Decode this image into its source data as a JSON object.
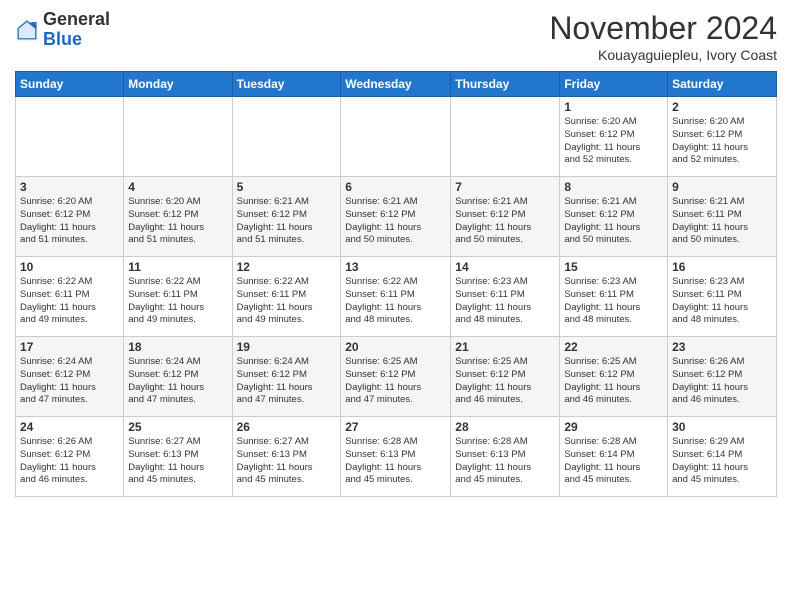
{
  "logo": {
    "general": "General",
    "blue": "Blue"
  },
  "header": {
    "month": "November 2024",
    "location": "Kouayaguiepleu, Ivory Coast"
  },
  "weekdays": [
    "Sunday",
    "Monday",
    "Tuesday",
    "Wednesday",
    "Thursday",
    "Friday",
    "Saturday"
  ],
  "weeks": [
    [
      {
        "day": "",
        "info": ""
      },
      {
        "day": "",
        "info": ""
      },
      {
        "day": "",
        "info": ""
      },
      {
        "day": "",
        "info": ""
      },
      {
        "day": "",
        "info": ""
      },
      {
        "day": "1",
        "info": "Sunrise: 6:20 AM\nSunset: 6:12 PM\nDaylight: 11 hours\nand 52 minutes."
      },
      {
        "day": "2",
        "info": "Sunrise: 6:20 AM\nSunset: 6:12 PM\nDaylight: 11 hours\nand 52 minutes."
      }
    ],
    [
      {
        "day": "3",
        "info": "Sunrise: 6:20 AM\nSunset: 6:12 PM\nDaylight: 11 hours\nand 51 minutes."
      },
      {
        "day": "4",
        "info": "Sunrise: 6:20 AM\nSunset: 6:12 PM\nDaylight: 11 hours\nand 51 minutes."
      },
      {
        "day": "5",
        "info": "Sunrise: 6:21 AM\nSunset: 6:12 PM\nDaylight: 11 hours\nand 51 minutes."
      },
      {
        "day": "6",
        "info": "Sunrise: 6:21 AM\nSunset: 6:12 PM\nDaylight: 11 hours\nand 50 minutes."
      },
      {
        "day": "7",
        "info": "Sunrise: 6:21 AM\nSunset: 6:12 PM\nDaylight: 11 hours\nand 50 minutes."
      },
      {
        "day": "8",
        "info": "Sunrise: 6:21 AM\nSunset: 6:12 PM\nDaylight: 11 hours\nand 50 minutes."
      },
      {
        "day": "9",
        "info": "Sunrise: 6:21 AM\nSunset: 6:11 PM\nDaylight: 11 hours\nand 50 minutes."
      }
    ],
    [
      {
        "day": "10",
        "info": "Sunrise: 6:22 AM\nSunset: 6:11 PM\nDaylight: 11 hours\nand 49 minutes."
      },
      {
        "day": "11",
        "info": "Sunrise: 6:22 AM\nSunset: 6:11 PM\nDaylight: 11 hours\nand 49 minutes."
      },
      {
        "day": "12",
        "info": "Sunrise: 6:22 AM\nSunset: 6:11 PM\nDaylight: 11 hours\nand 49 minutes."
      },
      {
        "day": "13",
        "info": "Sunrise: 6:22 AM\nSunset: 6:11 PM\nDaylight: 11 hours\nand 48 minutes."
      },
      {
        "day": "14",
        "info": "Sunrise: 6:23 AM\nSunset: 6:11 PM\nDaylight: 11 hours\nand 48 minutes."
      },
      {
        "day": "15",
        "info": "Sunrise: 6:23 AM\nSunset: 6:11 PM\nDaylight: 11 hours\nand 48 minutes."
      },
      {
        "day": "16",
        "info": "Sunrise: 6:23 AM\nSunset: 6:11 PM\nDaylight: 11 hours\nand 48 minutes."
      }
    ],
    [
      {
        "day": "17",
        "info": "Sunrise: 6:24 AM\nSunset: 6:12 PM\nDaylight: 11 hours\nand 47 minutes."
      },
      {
        "day": "18",
        "info": "Sunrise: 6:24 AM\nSunset: 6:12 PM\nDaylight: 11 hours\nand 47 minutes."
      },
      {
        "day": "19",
        "info": "Sunrise: 6:24 AM\nSunset: 6:12 PM\nDaylight: 11 hours\nand 47 minutes."
      },
      {
        "day": "20",
        "info": "Sunrise: 6:25 AM\nSunset: 6:12 PM\nDaylight: 11 hours\nand 47 minutes."
      },
      {
        "day": "21",
        "info": "Sunrise: 6:25 AM\nSunset: 6:12 PM\nDaylight: 11 hours\nand 46 minutes."
      },
      {
        "day": "22",
        "info": "Sunrise: 6:25 AM\nSunset: 6:12 PM\nDaylight: 11 hours\nand 46 minutes."
      },
      {
        "day": "23",
        "info": "Sunrise: 6:26 AM\nSunset: 6:12 PM\nDaylight: 11 hours\nand 46 minutes."
      }
    ],
    [
      {
        "day": "24",
        "info": "Sunrise: 6:26 AM\nSunset: 6:12 PM\nDaylight: 11 hours\nand 46 minutes."
      },
      {
        "day": "25",
        "info": "Sunrise: 6:27 AM\nSunset: 6:13 PM\nDaylight: 11 hours\nand 45 minutes."
      },
      {
        "day": "26",
        "info": "Sunrise: 6:27 AM\nSunset: 6:13 PM\nDaylight: 11 hours\nand 45 minutes."
      },
      {
        "day": "27",
        "info": "Sunrise: 6:28 AM\nSunset: 6:13 PM\nDaylight: 11 hours\nand 45 minutes."
      },
      {
        "day": "28",
        "info": "Sunrise: 6:28 AM\nSunset: 6:13 PM\nDaylight: 11 hours\nand 45 minutes."
      },
      {
        "day": "29",
        "info": "Sunrise: 6:28 AM\nSunset: 6:14 PM\nDaylight: 11 hours\nand 45 minutes."
      },
      {
        "day": "30",
        "info": "Sunrise: 6:29 AM\nSunset: 6:14 PM\nDaylight: 11 hours\nand 45 minutes."
      }
    ]
  ]
}
